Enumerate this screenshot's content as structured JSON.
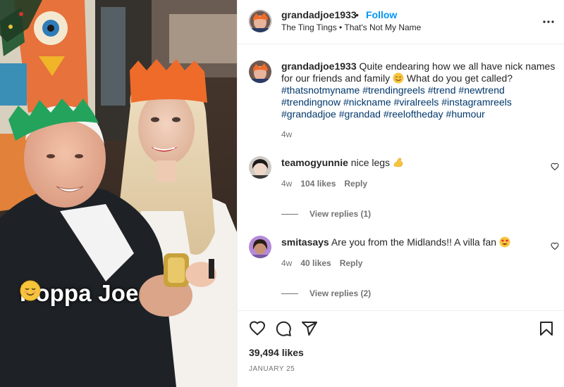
{
  "post": {
    "username": "grandadjoe1933",
    "follow_label": "Follow",
    "separator": "•",
    "audio": "The Ting Tings • That's Not My Name",
    "media_overlay_text": "Poppa Joe"
  },
  "caption": {
    "username": "grandadjoe1933",
    "text_before_emoji": " Quite endearing how we all have nick names for our friends and family ",
    "text_after_emoji": " What do you get called?",
    "hashtags": [
      "#thatsnotmyname",
      "#trendingreels",
      "#trend",
      "#newtrend",
      "#trendingnow",
      "#nickname",
      "#viralreels",
      "#instagramreels",
      "#grandadjoe",
      "#grandad",
      "#reeloftheday",
      "#humour"
    ],
    "time": "4w"
  },
  "comments": [
    {
      "username": "teamogyunnie",
      "text": " nice legs ",
      "emoji": "flexed-biceps",
      "time": "4w",
      "likes": "104 likes",
      "reply_label": "Reply",
      "view_replies": "View replies (1)"
    },
    {
      "username": "smitasays",
      "text": " Are you from the Midlands!! A villa fan ",
      "emoji": "heart-eyes",
      "time": "4w",
      "likes": "40 likes",
      "reply_label": "Reply",
      "view_replies": "View replies (2)"
    }
  ],
  "footer": {
    "likes": "39,494 likes",
    "date": "JANUARY 25"
  },
  "icons": {
    "more": "more-horizontal-icon",
    "like": "heart-icon",
    "comment": "comment-icon",
    "share": "share-icon",
    "save": "bookmark-icon"
  },
  "colors": {
    "follow": "#0095f6",
    "hashtag": "#00376b",
    "secondary_text": "#737373",
    "border": "#efefef"
  }
}
